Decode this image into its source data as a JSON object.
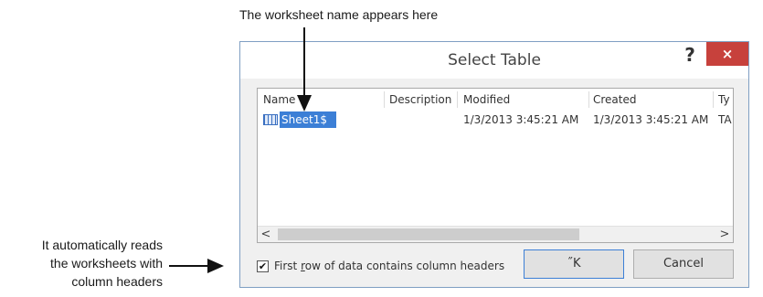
{
  "annotations": {
    "top": "The worksheet name appears here",
    "left_lines": [
      "It automatically reads",
      "the worksheets with",
      "column headers"
    ]
  },
  "dialog": {
    "title": "Select Table",
    "help_label": "?",
    "close_label": "×",
    "columns": [
      "Name",
      "Description",
      "Modified",
      "Created",
      "Ty"
    ],
    "rows": [
      {
        "name": "Sheet1$",
        "description": "",
        "modified": "1/3/2013 3:45:21 AM",
        "created": "1/3/2013 3:45:21 AM",
        "type": "TA"
      }
    ],
    "scroll_left": "<",
    "scroll_right": ">",
    "checkbox": {
      "checked": true,
      "check_glyph": "✔",
      "label_pre": "First ",
      "label_accel": "r",
      "label_post": "ow of data contains column headers"
    },
    "ok_label": "˝K",
    "cancel_label": "Cancel"
  },
  "colors": {
    "selection": "#3c7fd6",
    "close_button": "#c7413c",
    "dialog_border": "#7f9fc3"
  }
}
